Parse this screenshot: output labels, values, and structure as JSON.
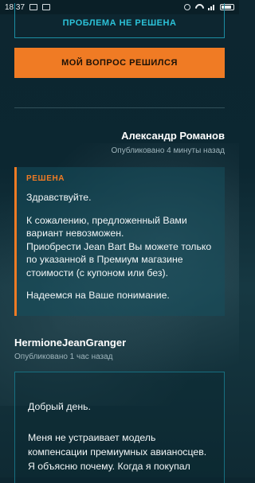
{
  "status_bar": {
    "time": "18:37",
    "icons": [
      "gallery-icon",
      "mail-icon",
      "alarm-icon",
      "wifi-icon",
      "signal-icon",
      "battery-icon"
    ]
  },
  "actions": {
    "unsolved_label": "ПРОБЛЕМА НЕ РЕШЕНА",
    "solved_label": "МОЙ ВОПРОС РЕШИЛСЯ"
  },
  "answer": {
    "author": "Александр Романов",
    "published": "Опубликовано 4 минуты назад",
    "status": "РЕШЕНА",
    "paragraphs": [
      "Здравствуйте.",
      "К сожалению, предложенный Вами вариант невозможен.\nПриобрести Jean Bart Вы можете только по указанной в Премиум магазине стоимости (с купоном или без).",
      "Надеемся на Ваше понимание."
    ]
  },
  "question": {
    "author": "HermioneJeanGranger",
    "published": "Опубликовано 1 час назад",
    "paragraphs": [
      "Добрый день.",
      "Меня не устраивает модель компенсации премиумных авианосцев. Я объясню почему. Когда я покупал"
    ]
  },
  "colors": {
    "accent_orange": "#f07b24",
    "accent_cyan": "#2cc2d8",
    "background": "#0d2630"
  }
}
